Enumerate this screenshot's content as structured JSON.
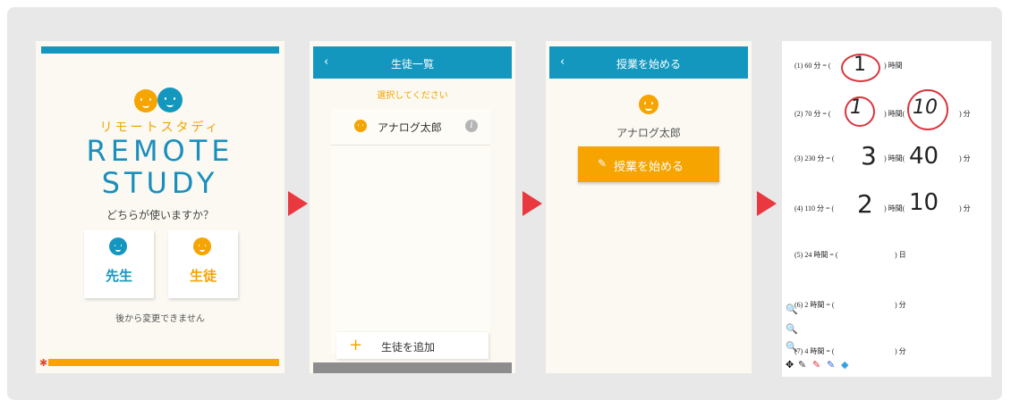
{
  "screen1": {
    "kana_title": "リモートスタディ",
    "logo_line1": "REMOTE",
    "logo_line2": "STUDY",
    "question": "どちらが使いますか？",
    "teacher_label": "先生",
    "student_label": "生徒",
    "note": "後から変更できません",
    "colors": {
      "teacher": "#1497bf",
      "student": "#f5a400",
      "topbar": "#1497bf",
      "bottombar": "#f5a400"
    }
  },
  "screen2": {
    "back": "‹",
    "title": "生徒一覧",
    "prompt": "選択してください",
    "students": [
      "アナログ太郎"
    ],
    "info_icon": "i",
    "add_plus": "+",
    "add_label": "生徒を追加"
  },
  "screen3": {
    "back": "‹",
    "title": "授業を始める",
    "student_name": "アナログ太郎",
    "start_button": "授業を始める",
    "pencil_icon": "✎"
  },
  "screen4": {
    "questions": [
      {
        "text": "(1)  60 分 = (",
        "suffix1": ") 時間",
        "suffix2": "",
        "ans1": "1",
        "ans2": ""
      },
      {
        "text": "(2)  70 分 = (",
        "suffix1": ") 時間(",
        "suffix2": ") 分",
        "ans1": "1",
        "ans2": "10"
      },
      {
        "text": "(3)  230 分 = (",
        "suffix1": ") 時間(",
        "suffix2": ") 分",
        "ans1": "3",
        "ans2": "40"
      },
      {
        "text": "(4)  110 分 = (",
        "suffix1": ") 時間(",
        "suffix2": ") 分",
        "ans1": "2",
        "ans2": "10"
      },
      {
        "text": "(5)  24 時間 = (",
        "suffix1": ") 日",
        "suffix2": "",
        "ans1": "",
        "ans2": ""
      },
      {
        "text": "(6)  2 時間 = (",
        "suffix1": ") 分",
        "suffix2": "",
        "ans1": "",
        "ans2": ""
      },
      {
        "text": "(7)  4 時間 = (",
        "suffix1": ") 分",
        "suffix2": "",
        "ans1": "",
        "ans2": ""
      }
    ],
    "tools": [
      "zoom-in-icon",
      "zoom-out-icon",
      "zoom-reset-icon",
      "move-icon",
      "pencil-black-icon",
      "pencil-red-icon",
      "pencil-blue-icon",
      "eraser-icon"
    ]
  },
  "arrow_color": "#e9383f"
}
